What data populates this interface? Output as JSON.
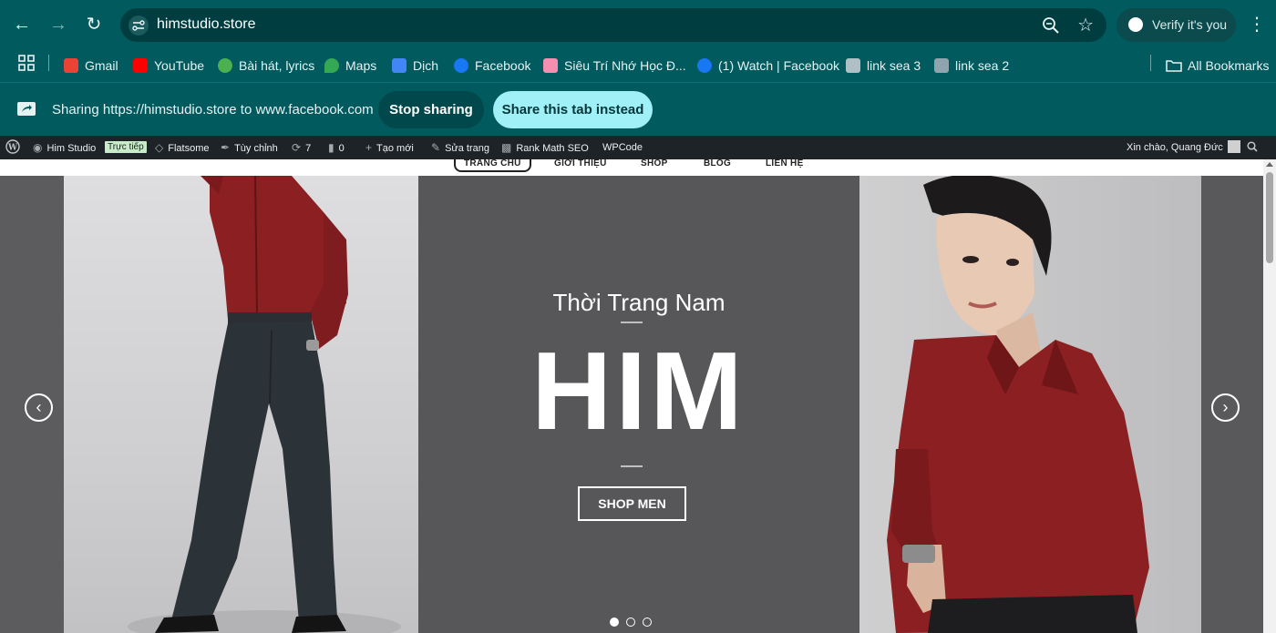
{
  "browser": {
    "url": "himstudio.store",
    "verify_label": "Verify it's you",
    "bookmarks": [
      {
        "label": "Gmail",
        "icon": "gmail-icon",
        "color": "#ea4335"
      },
      {
        "label": "YouTube",
        "icon": "youtube-icon",
        "color": "#ff0000"
      },
      {
        "label": "Bài hát, lyrics",
        "icon": "chrome-icon",
        "color": "#4caf50"
      },
      {
        "label": "Maps",
        "icon": "maps-icon",
        "color": "#34a853"
      },
      {
        "label": "Dịch",
        "icon": "translate-icon",
        "color": "#4285f4"
      },
      {
        "label": "Facebook",
        "icon": "facebook-icon",
        "color": "#1877f2"
      },
      {
        "label": "Siêu Trí Nhớ Học Đ...",
        "icon": "brain-icon",
        "color": "#f48fb1"
      },
      {
        "label": "(1) Watch | Facebook",
        "icon": "facebook-icon",
        "color": "#1877f2"
      },
      {
        "label": "link sea 3",
        "icon": "page-icon",
        "color": "#b0bec5"
      },
      {
        "label": "link sea 2",
        "icon": "page-icon",
        "color": "#90a4ae"
      }
    ],
    "all_bookmarks": "All Bookmarks",
    "share": {
      "message": "Sharing https://himstudio.store to www.facebook.com",
      "stop_label": "Stop sharing",
      "share_tab_label": "Share this tab instead"
    }
  },
  "adminbar": {
    "site": "Him Studio",
    "live": "Trực tiếp",
    "theme": "Flatsome",
    "customize": "Tùy chỉnh",
    "updates": "7",
    "comments": "0",
    "new": "Tạo mới",
    "edit": "Sửa trang",
    "seo": "Rank Math SEO",
    "wpcode": "WPCode",
    "greeting": "Xin chào, Quang Đức"
  },
  "site": {
    "nav": [
      "TRANG CHỦ",
      "GIỚI THIỆU",
      "SHOP",
      "BLOG",
      "LIÊN HỆ"
    ],
    "hero": {
      "subtitle": "Thời Trang Nam",
      "title": "HIM",
      "button": "SHOP MEN",
      "prev": "‹",
      "next": "›",
      "slide_count": 3,
      "active_slide": 1
    }
  },
  "colors": {
    "chrome": "#005a5e",
    "share_button": "#9ff0f7",
    "shirt": "#8b1f22"
  }
}
